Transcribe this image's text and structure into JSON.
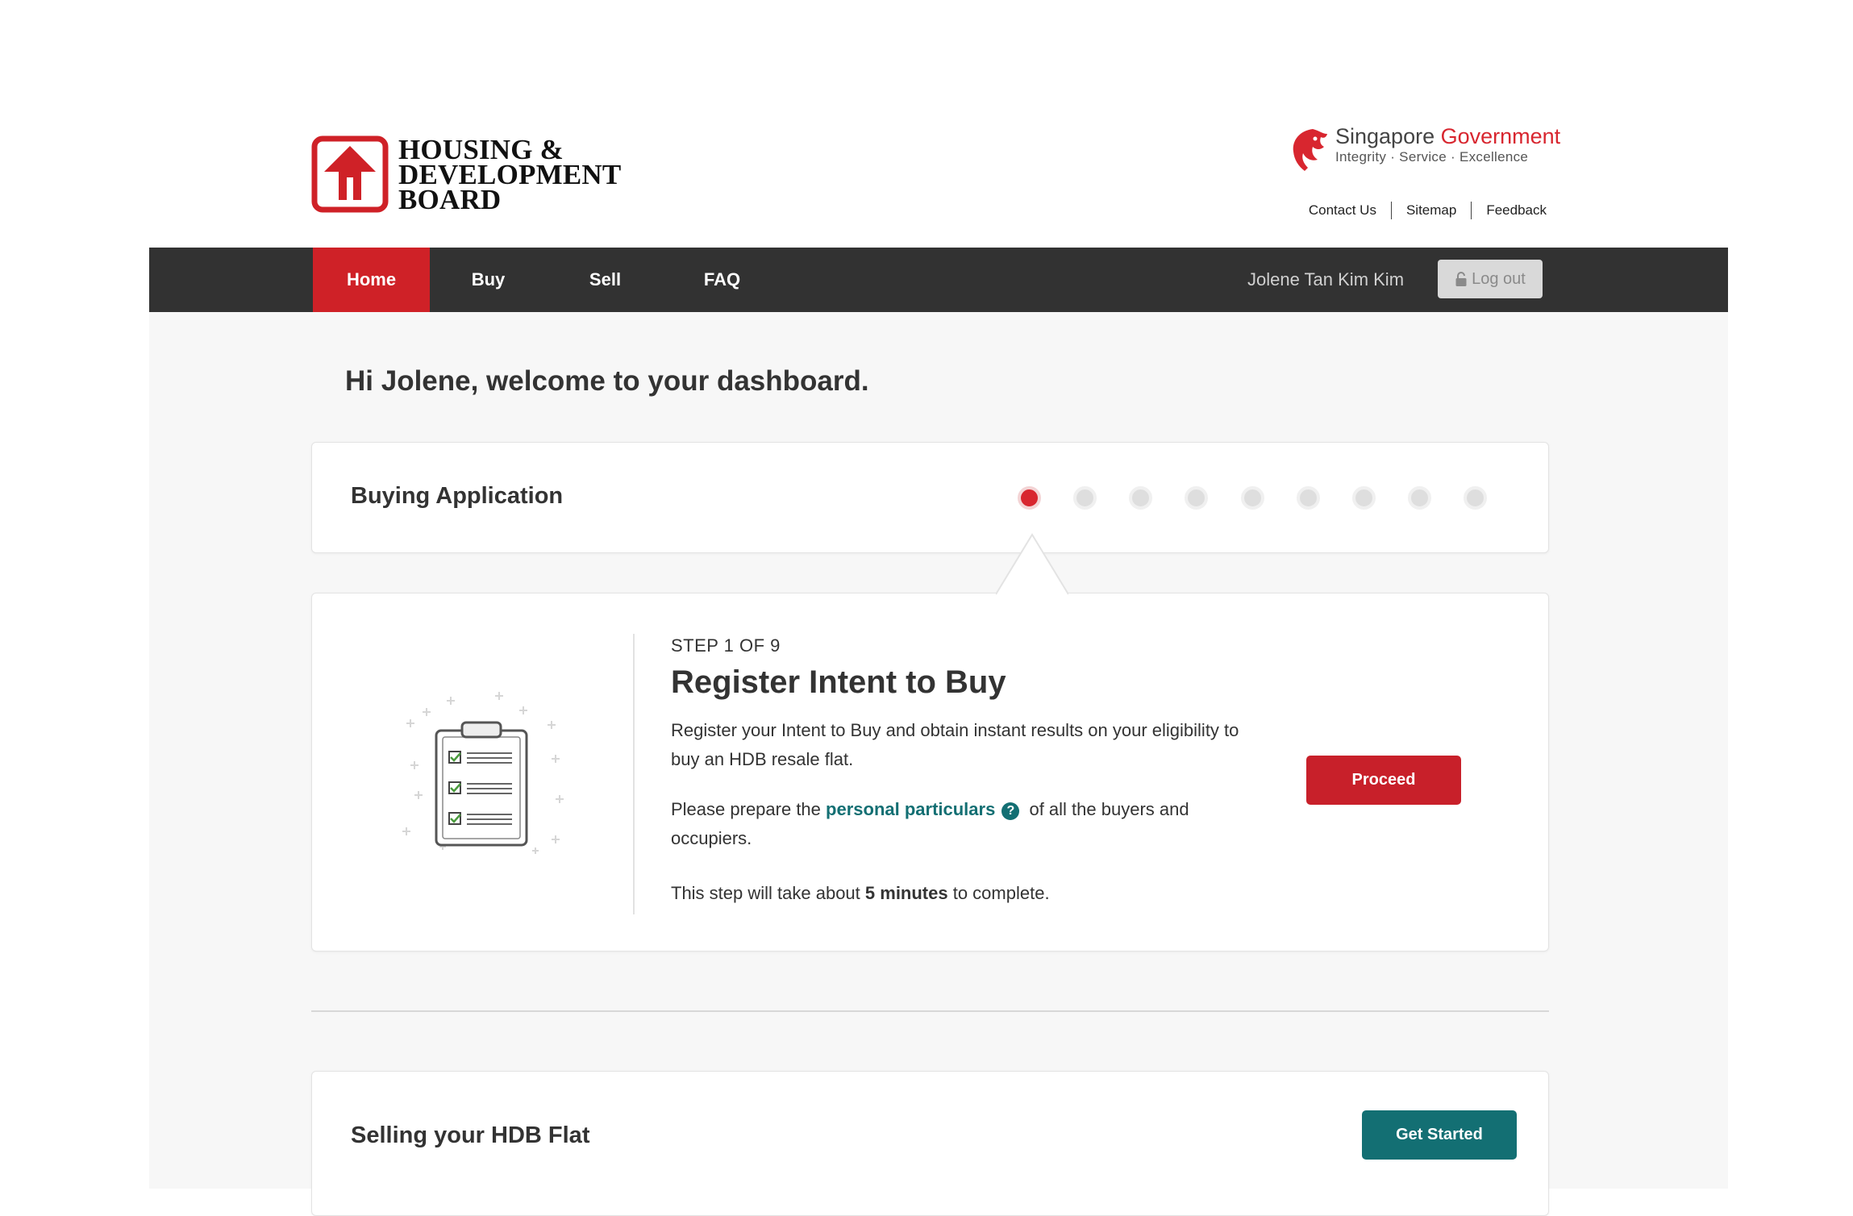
{
  "brand": {
    "logo_lines": [
      "HOUSING &",
      "DEVELOPMENT",
      "BOARD"
    ],
    "gov_name_part1": "Singapore ",
    "gov_name_part2": "Government",
    "gov_tagline": "Integrity · Service · Excellence"
  },
  "utility_links": [
    "Contact Us",
    "Sitemap",
    "Feedback"
  ],
  "nav": {
    "items": [
      "Home",
      "Buy",
      "Sell",
      "FAQ"
    ],
    "active": "Home",
    "user_name": "Jolene Tan Kim Kim",
    "logout_label": "Log out"
  },
  "dashboard": {
    "welcome": "Hi Jolene, welcome to your dashboard."
  },
  "buying_application": {
    "title": "Buying Application",
    "total_steps": 9,
    "current_step": 1
  },
  "step": {
    "label": "STEP 1 OF 9",
    "title": "Register Intent to Buy",
    "description": "Register your Intent to Buy and obtain instant results on your eligibility to buy an HDB resale flat.",
    "prepare_prefix": "Please prepare the ",
    "prepare_link": "personal particulars",
    "prepare_suffix": " of all the buyers and occupiers.",
    "duration_prefix": "This step will take about ",
    "duration_value": "5 minutes",
    "duration_suffix": " to complete.",
    "proceed_label": "Proceed"
  },
  "selling": {
    "title": "Selling your HDB Flat",
    "button_label": "Get Started"
  },
  "colors": {
    "brand_red": "#cf2127",
    "teal": "#136f73",
    "nav_bg": "#323232"
  }
}
